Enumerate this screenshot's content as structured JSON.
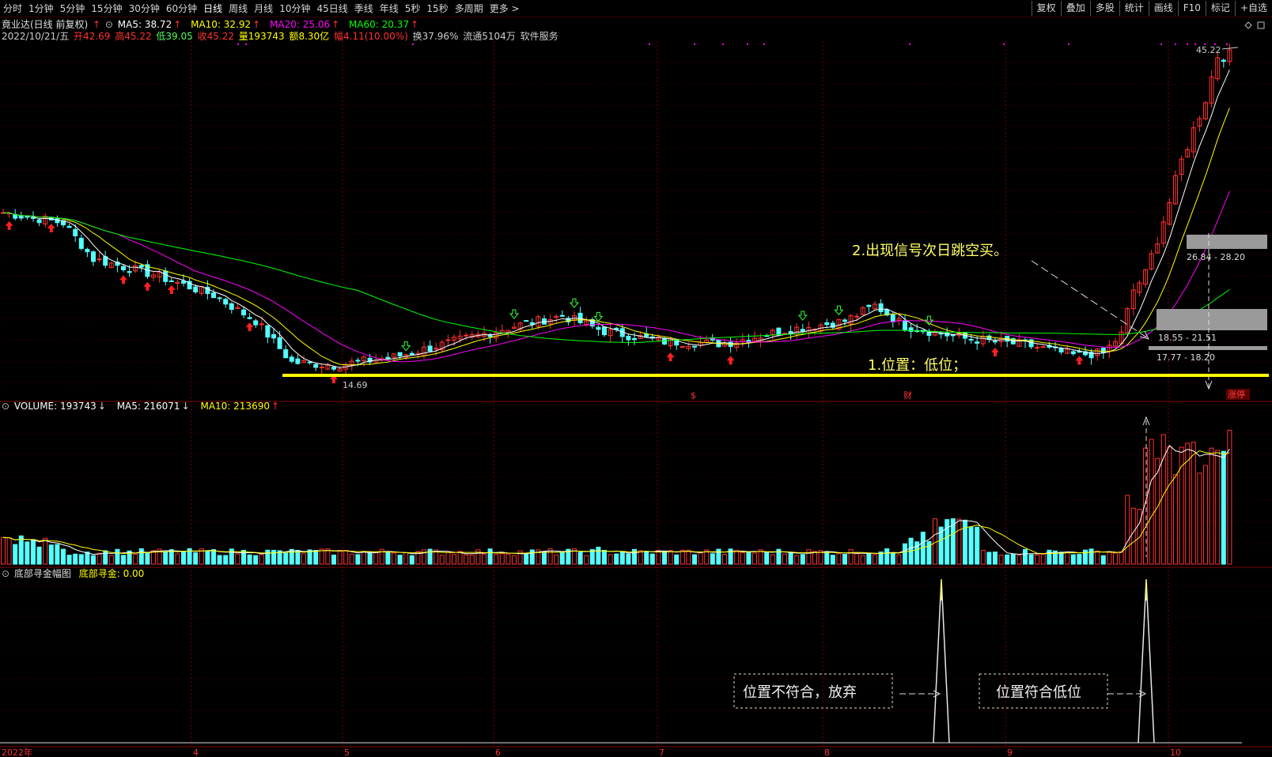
{
  "toolbar": {
    "periods": [
      "分时",
      "1分钟",
      "5分钟",
      "15分钟",
      "30分钟",
      "60分钟",
      "日线",
      "周线",
      "月线",
      "10分钟",
      "45日线",
      "季线",
      "年线",
      "5秒",
      "15秒",
      "多周期",
      "更多 >"
    ],
    "active_period": "日线",
    "actions": [
      "复权",
      "叠加",
      "多股",
      "统计",
      "画线",
      "F10",
      "标记",
      "+自选"
    ]
  },
  "main_panel": {
    "title": "竟业达(日线 前复权)",
    "ma": [
      {
        "label": "MA5: 38.72",
        "color": "#ffffff"
      },
      {
        "label": "MA10: 32.92",
        "color": "#ffff00"
      },
      {
        "label": "MA20: 25.06",
        "color": "#ff00ff"
      },
      {
        "label": "MA60: 20.37",
        "color": "#00ff00"
      }
    ],
    "date": "2022/10/21/五",
    "open": "开42.69",
    "high": "高45.22",
    "low": "低39.05",
    "close": "收45.22",
    "volume": "量193743",
    "amount": "额8.30亿",
    "change": "幅4.11(10.00%)",
    "turnover": "换37.96%",
    "float": "流通5104万",
    "sector": "软件服务",
    "price_high_label": "45.22",
    "price_low_label": "14.69",
    "chip_labels": [
      "26.84 - 28.20",
      "18.55 - 21.51",
      "17.77 - 18.20"
    ],
    "event_marks": [
      "$",
      "财"
    ],
    "limit_up_label": "涨停"
  },
  "annotations": {
    "signal_text": "2.出现信号次日跳空买。",
    "position_text": "1.位置：低位；",
    "reject_box": "位置不符合，放弃",
    "accept_box": "位置符合低位"
  },
  "volume_panel": {
    "volume": "VOLUME: 193743",
    "ma5": "MA5: 216071",
    "ma10": "MA10: 213690"
  },
  "indicator_panel": {
    "name": "底部寻金幅图",
    "value": "底部寻金: 0.00"
  },
  "x_axis": {
    "labels": [
      "2022年",
      "4",
      "5",
      "6",
      "7",
      "8",
      "9",
      "10"
    ]
  },
  "colors": {
    "up": "#ff3232",
    "down": "#54ffff",
    "ma5": "#ffffff",
    "ma10": "#ffff00",
    "ma20": "#ff00ff",
    "ma60": "#00ff00",
    "grid": "#800000",
    "support_line": "#ffff00"
  }
}
